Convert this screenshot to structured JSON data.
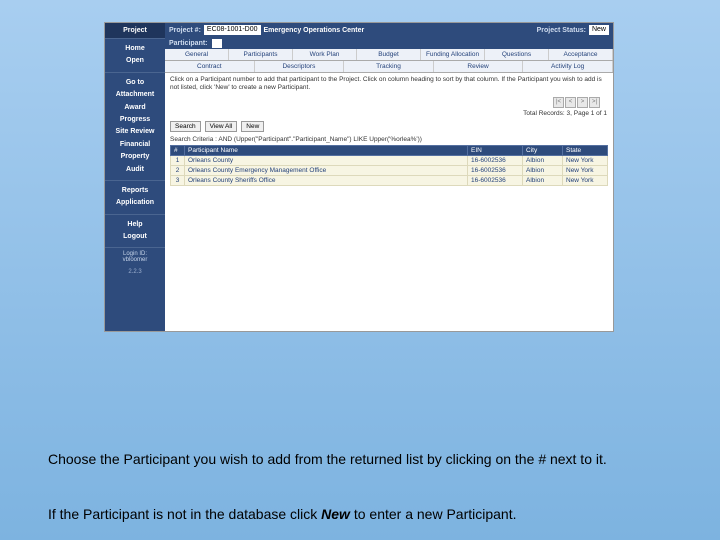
{
  "header": {
    "project_num_label": "Project #:",
    "project_num": "EC08-1001-D00",
    "project_title": "Emergency Operations Center",
    "status_label": "Project Status:",
    "status": "New",
    "participant_label": "Participant:"
  },
  "sidebar": {
    "project_header": "Project",
    "group1": [
      "Home",
      "Open"
    ],
    "group2_header": "Go to",
    "group2": [
      "Attachment",
      "Award",
      "Progress",
      "Site Review",
      "Financial",
      "Property",
      "Audit"
    ],
    "group3": [
      "Reports",
      "Application"
    ],
    "group4": [
      "Help",
      "Logout"
    ],
    "login_label": "Login ID:",
    "login_user": "vbloomer",
    "version": "2.2.3"
  },
  "tabs": [
    "General",
    "Participants",
    "Work Plan",
    "Budget",
    "Funding Allocation",
    "Questions",
    "Acceptance"
  ],
  "subtabs": [
    "Contract",
    "Descriptors",
    "Tracking",
    "Review",
    "Activity Log"
  ],
  "instruction": "Click on a Participant number to add that participant to the Project. Click on column heading to sort by that column. If the Participant you wish to add is not listed, click 'New' to create a new Participant.",
  "buttons": {
    "search": "Search",
    "view_all": "View All",
    "new": "New"
  },
  "pager": [
    "|<",
    "<",
    ">",
    ">|"
  ],
  "records_info": "Total Records: 3, Page 1 of 1",
  "criteria": "Search Criteria : AND (Upper(\"Participant\".\"Participant_Name\") LIKE Upper('%orlea%'))",
  "table": {
    "headers": [
      "#",
      "Participant Name",
      "EIN",
      "City",
      "State"
    ],
    "rows": [
      {
        "n": "1",
        "name": "Orleans County",
        "ein": "16-6002536",
        "city": "Albion",
        "state": "New York"
      },
      {
        "n": "2",
        "name": "Orleans County Emergency Management Office",
        "ein": "16-6002536",
        "city": "Albion",
        "state": "New York"
      },
      {
        "n": "3",
        "name": "Orleans County Sheriffs Office",
        "ein": "16-6002536",
        "city": "Albion",
        "state": "New York"
      }
    ]
  },
  "captions": {
    "line1a": "Choose the Participant you wish to add from the returned list by clicking on the ",
    "line1b": "#",
    "line1c": " next to it.",
    "line2a": "If the Participant is not in the database click ",
    "line2b": "New",
    "line2c": " to enter a new Participant."
  }
}
